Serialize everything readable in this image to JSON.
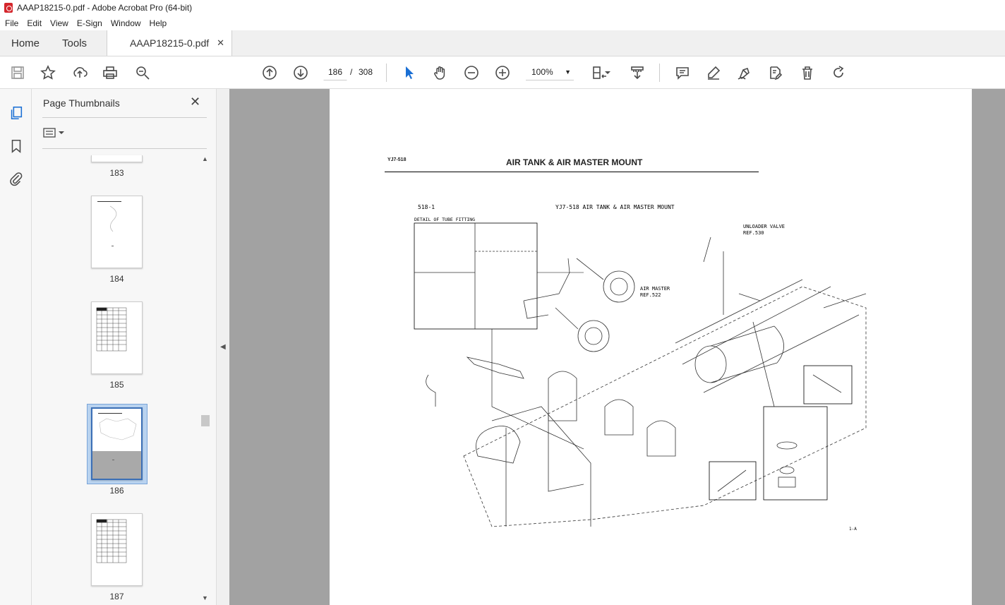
{
  "window": {
    "title": "AAAP18215-0.pdf - Adobe Acrobat Pro (64-bit)"
  },
  "menu": [
    "File",
    "Edit",
    "View",
    "E-Sign",
    "Window",
    "Help"
  ],
  "tabs": {
    "home": "Home",
    "tools": "Tools",
    "document": "AAAP18215-0.pdf",
    "close": "✕"
  },
  "toolbar": {
    "current_page": "186",
    "separator": "/",
    "total_pages": "308",
    "zoom": "100%"
  },
  "panel": {
    "title": "Page Thumbnails",
    "thumbnails": [
      {
        "label": "183"
      },
      {
        "label": "184"
      },
      {
        "label": "185"
      },
      {
        "label": "186",
        "selected": true
      },
      {
        "label": "187"
      }
    ]
  },
  "document": {
    "header_id": "YJ7-518",
    "header_title": "AIR TANK & AIR MASTER MOUNT",
    "figure_ref": "518-1",
    "figure_caption": "YJ7-518    AIR TANK & AIR MASTER MOUNT",
    "detail_label": "DETAIL OF TUBE FITTING",
    "callouts": {
      "unloader": "UNLOADER VALVE",
      "unloader_ref": "REF.530",
      "airmaster": "AIR MASTER",
      "airmaster_ref": "REF.522"
    },
    "footer_code": "1-A"
  }
}
